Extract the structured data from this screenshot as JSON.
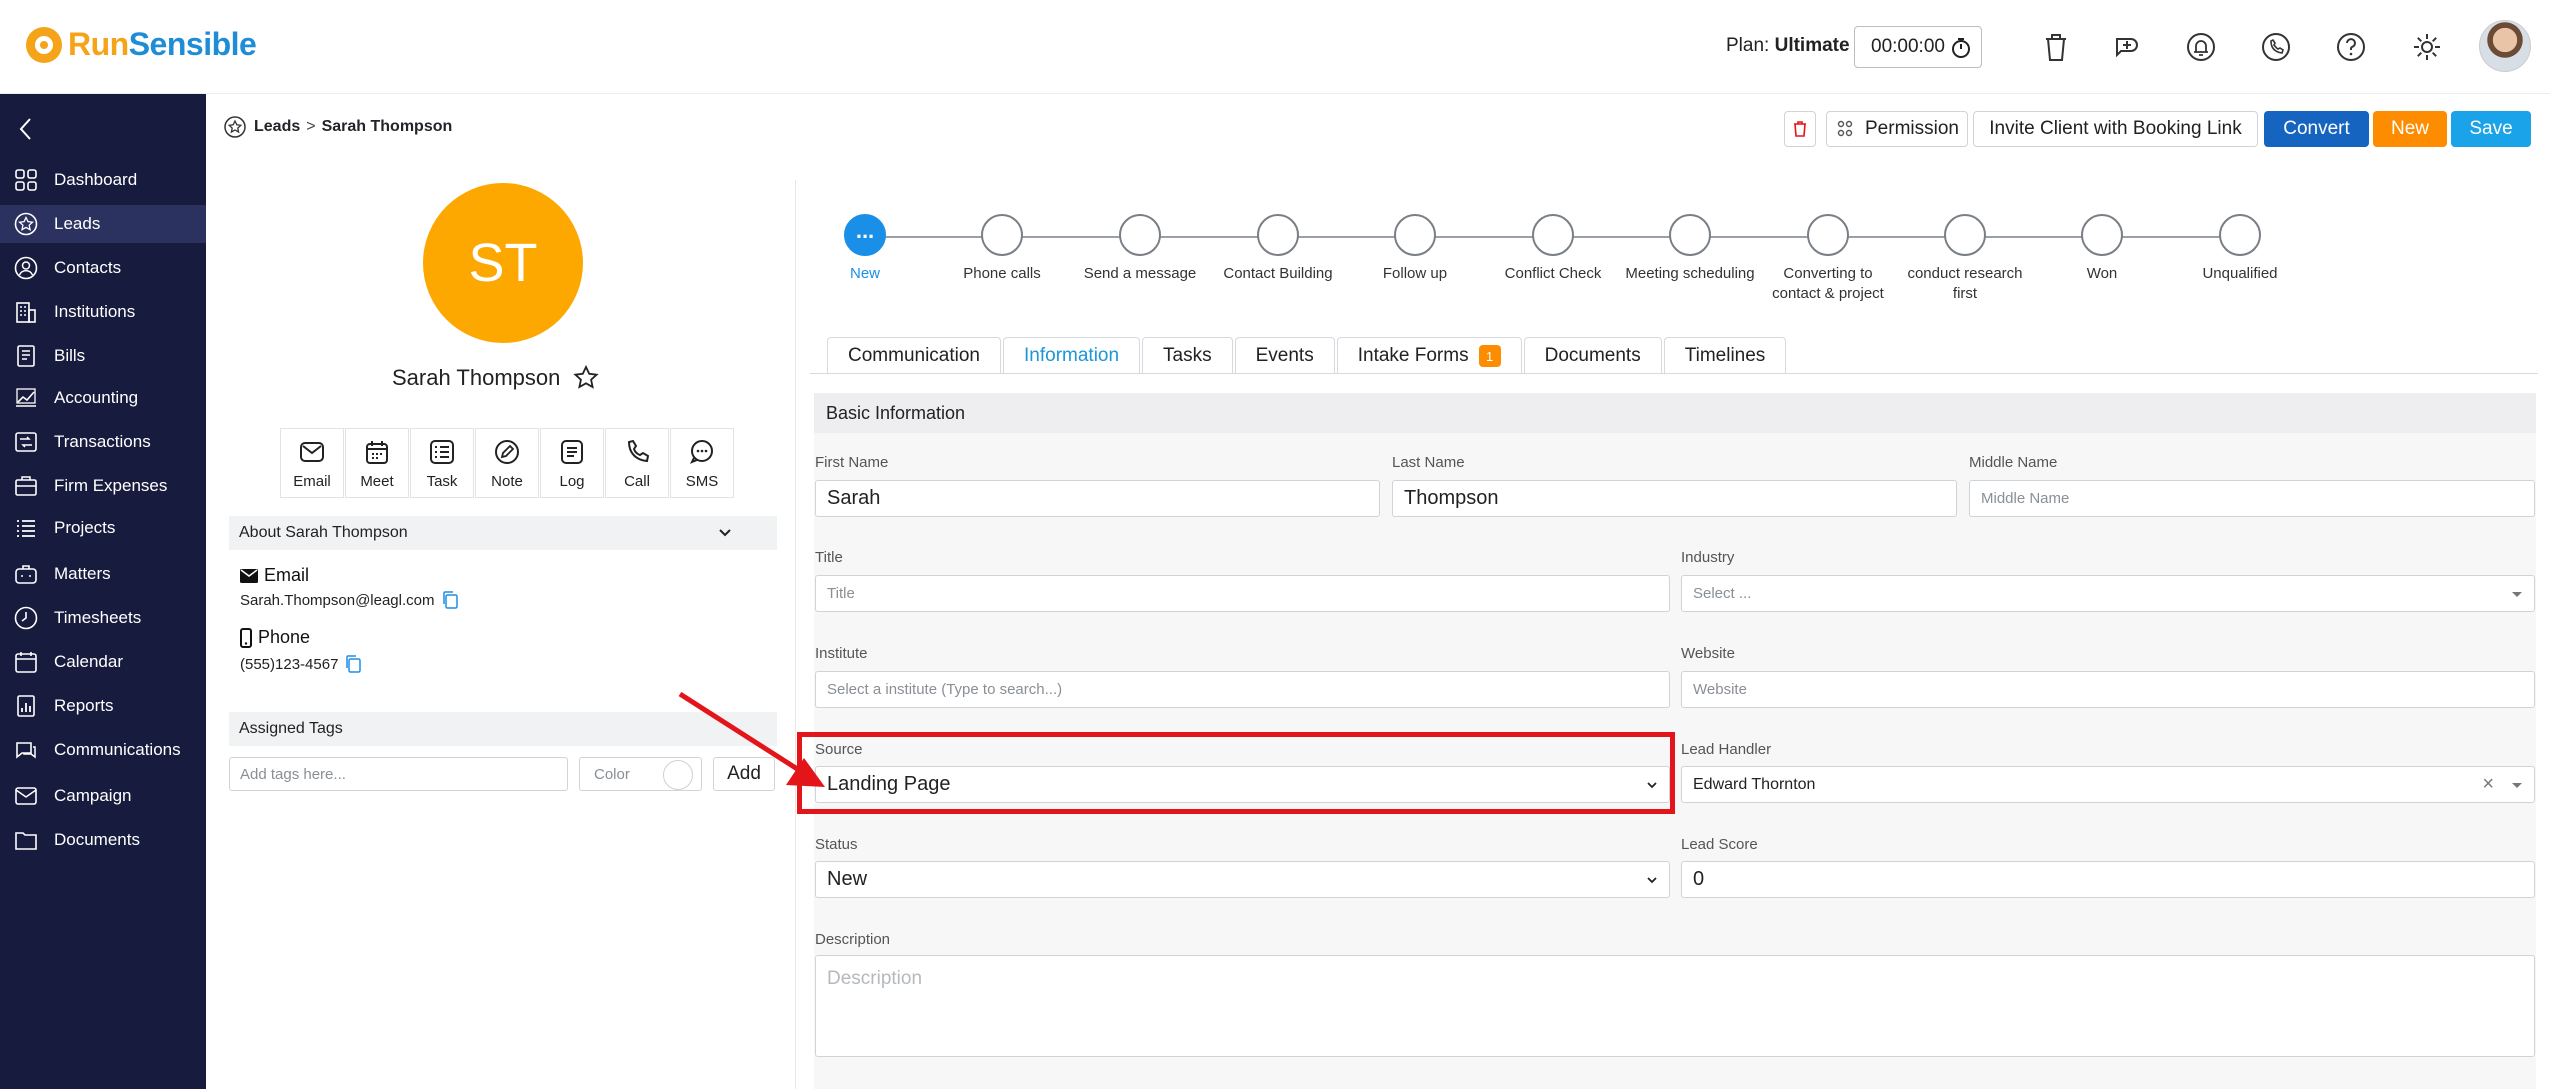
{
  "brand": {
    "part1": "Run",
    "part2": "Sensible"
  },
  "header": {
    "plan_label": "Plan:",
    "plan_value": "Ultimate",
    "timer": "00:00:00"
  },
  "header_icons": [
    "trash-icon",
    "add-task-icon",
    "bell-icon",
    "phone-icon",
    "help-icon",
    "gear-icon"
  ],
  "sidebar": {
    "items": [
      {
        "label": "Dashboard",
        "icon": "dashboard-icon"
      },
      {
        "label": "Leads",
        "icon": "leads-star-icon",
        "active": true
      },
      {
        "label": "Contacts",
        "icon": "contacts-icon"
      },
      {
        "label": "Institutions",
        "icon": "institutions-icon"
      },
      {
        "label": "Bills",
        "icon": "bills-icon"
      },
      {
        "label": "Accounting",
        "icon": "accounting-icon"
      },
      {
        "label": "Transactions",
        "icon": "transactions-icon"
      },
      {
        "label": "Firm Expenses",
        "icon": "firm-expenses-icon"
      },
      {
        "label": "Projects",
        "icon": "projects-icon"
      },
      {
        "label": "Matters",
        "icon": "matters-icon"
      },
      {
        "label": "Timesheets",
        "icon": "timesheets-icon"
      },
      {
        "label": "Calendar",
        "icon": "calendar-icon"
      },
      {
        "label": "Reports",
        "icon": "reports-icon"
      },
      {
        "label": "Communications",
        "icon": "communications-icon"
      },
      {
        "label": "Campaign",
        "icon": "campaign-icon"
      },
      {
        "label": "Documents",
        "icon": "documents-icon"
      }
    ]
  },
  "breadcrumb": {
    "root": "Leads",
    "current": "Sarah Thompson"
  },
  "actions": {
    "permission": "Permission",
    "invite": "Invite Client with Booking Link",
    "convert": "Convert",
    "new": "New",
    "save": "Save"
  },
  "profile": {
    "initials": "ST",
    "name": "Sarah Thompson",
    "quick_actions": [
      {
        "label": "Email",
        "icon": "email-icon"
      },
      {
        "label": "Meet",
        "icon": "meet-calendar-icon"
      },
      {
        "label": "Task",
        "icon": "task-list-icon"
      },
      {
        "label": "Note",
        "icon": "note-pencil-icon"
      },
      {
        "label": "Log",
        "icon": "log-icon"
      },
      {
        "label": "Call",
        "icon": "call-icon"
      },
      {
        "label": "SMS",
        "icon": "sms-icon"
      }
    ],
    "about_title": "About Sarah Thompson",
    "email_label": "Email",
    "email_value": "Sarah.Thompson@leagl.com",
    "phone_label": "Phone",
    "phone_value": "(555)123-4567",
    "tags_title": "Assigned Tags",
    "tags_placeholder": "Add tags here...",
    "color_label": "Color",
    "add_label": "Add"
  },
  "stages": [
    {
      "label": "New",
      "current": true,
      "dot_text": "..."
    },
    {
      "label": "Phone calls"
    },
    {
      "label": "Send a message"
    },
    {
      "label": "Contact Building"
    },
    {
      "label": "Follow up"
    },
    {
      "label": "Conflict Check"
    },
    {
      "label": "Meeting scheduling"
    },
    {
      "label": "Converting to contact & project"
    },
    {
      "label": "conduct research first"
    },
    {
      "label": "Won"
    },
    {
      "label": "Unqualified"
    }
  ],
  "tabs": [
    {
      "label": "Communication"
    },
    {
      "label": "Information",
      "active": true
    },
    {
      "label": "Tasks"
    },
    {
      "label": "Events"
    },
    {
      "label": "Intake Forms",
      "badge": "1"
    },
    {
      "label": "Documents"
    },
    {
      "label": "Timelines"
    }
  ],
  "form": {
    "section_title": "Basic Information",
    "first_name": {
      "label": "First Name",
      "value": "Sarah"
    },
    "last_name": {
      "label": "Last Name",
      "value": "Thompson"
    },
    "middle_name": {
      "label": "Middle Name",
      "placeholder": "Middle Name"
    },
    "title": {
      "label": "Title",
      "placeholder": "Title"
    },
    "industry": {
      "label": "Industry",
      "placeholder": "Select ..."
    },
    "institute": {
      "label": "Institute",
      "placeholder": "Select a institute (Type to search...)"
    },
    "website": {
      "label": "Website",
      "placeholder": "Website"
    },
    "source": {
      "label": "Source",
      "value": "Landing Page"
    },
    "lead_handler": {
      "label": "Lead Handler",
      "value": "Edward Thornton"
    },
    "status": {
      "label": "Status",
      "value": "New"
    },
    "lead_score": {
      "label": "Lead Score",
      "value": "0"
    },
    "description": {
      "label": "Description",
      "placeholder": "Description"
    }
  },
  "colors": {
    "sidebar_bg": "#171b3d",
    "accent_blue": "#1a8fe8",
    "convert": "#1565c0",
    "new": "#fd8c00",
    "save": "#1aa3e8",
    "avatar": "#fda800",
    "annotation": "#e3151b"
  }
}
